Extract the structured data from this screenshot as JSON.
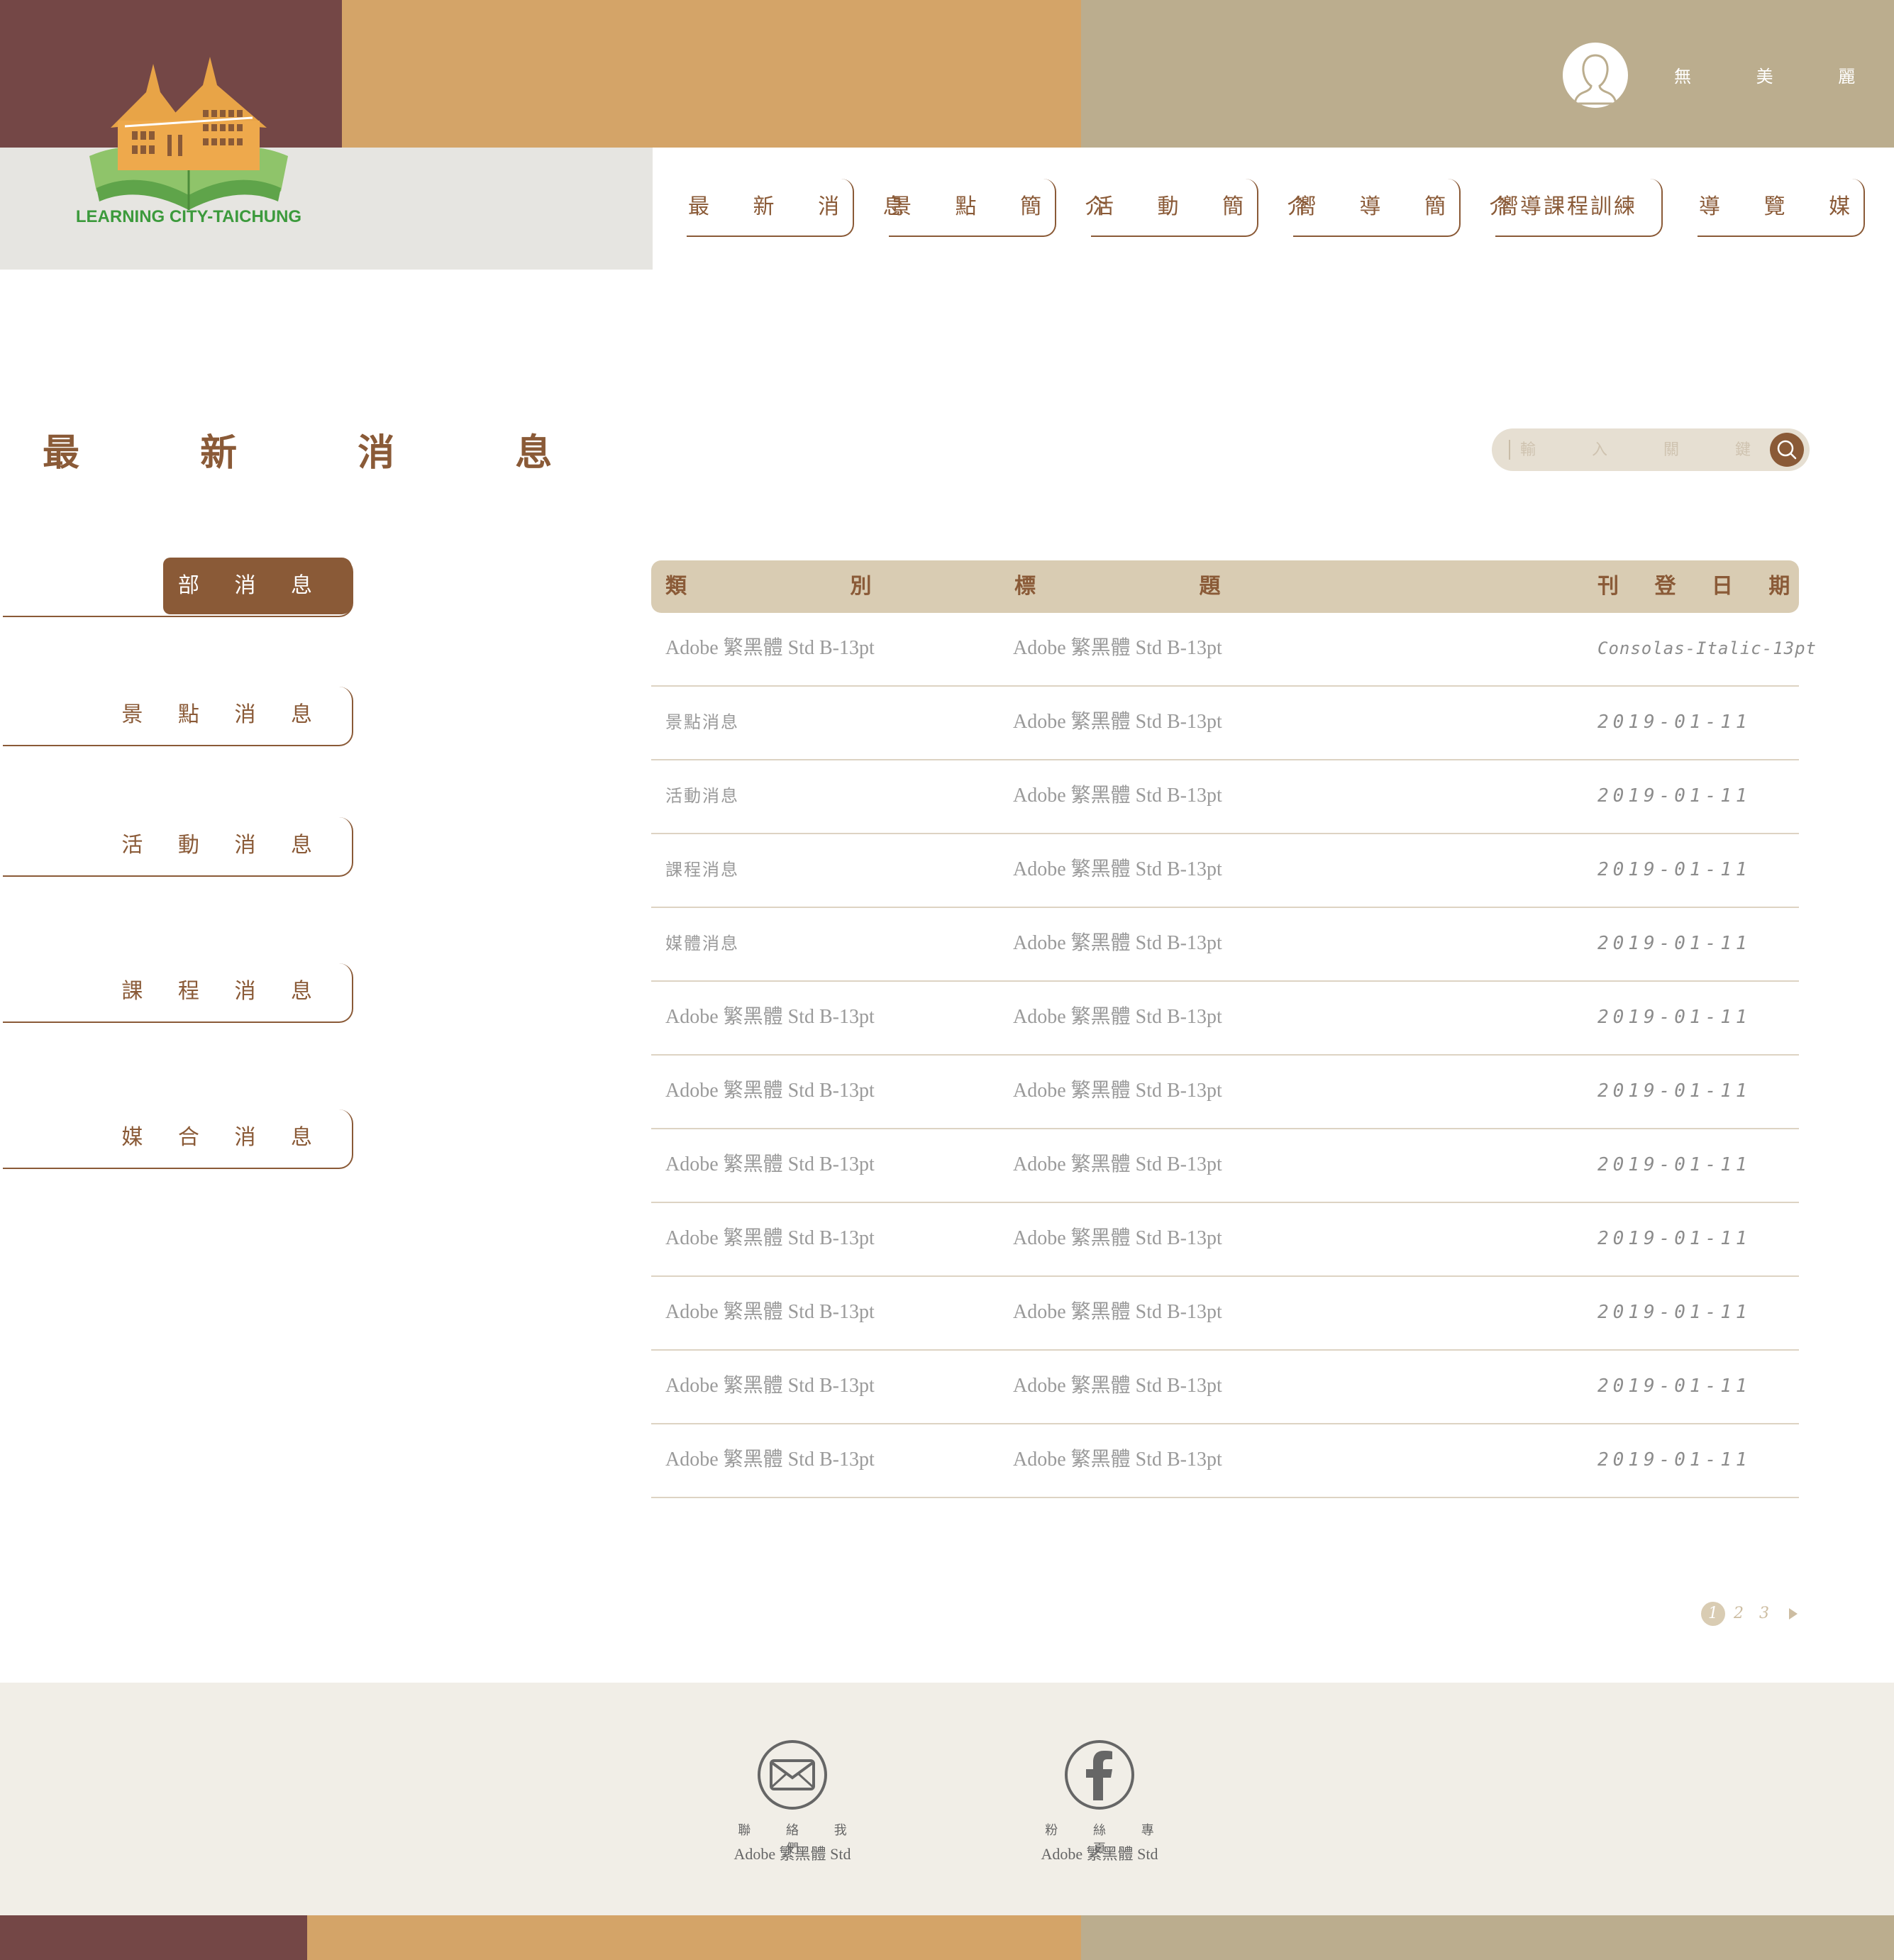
{
  "header": {
    "logo_text": "LEARNING CITY-TAICHUNG",
    "user_name": "無 美 麗",
    "nav": [
      "最 新 消 息",
      "景 點 簡 介",
      "活 動 簡 介",
      "嚮 導 簡 介",
      "嚮導課程訓練",
      "導 覽 媒 合"
    ]
  },
  "page": {
    "title": "最 新 消 息",
    "search_placeholder": "輸 入 關 鍵 字"
  },
  "sidebar": {
    "items": [
      "全 部 消 息",
      "景 點 消 息",
      "活 動 消 息",
      "課 程 消 息",
      "媒 合 消 息"
    ],
    "active_index": 0
  },
  "table": {
    "headers": {
      "category": "類 別",
      "title": "標 題",
      "date": "刊 登 日 期"
    },
    "rows": [
      {
        "category": "Adobe 繁黑體 Std B-13pt",
        "title": "Adobe 繁黑體 Std B-13pt",
        "date": "Consolas-Italic-13pt"
      },
      {
        "category": "景點消息",
        "title": "Adobe 繁黑體 Std B-13pt",
        "date": "2019-01-11"
      },
      {
        "category": "活動消息",
        "title": "Adobe 繁黑體 Std B-13pt",
        "date": "2019-01-11"
      },
      {
        "category": "課程消息",
        "title": "Adobe 繁黑體 Std B-13pt",
        "date": "2019-01-11"
      },
      {
        "category": "媒體消息",
        "title": "Adobe 繁黑體 Std B-13pt",
        "date": "2019-01-11"
      },
      {
        "category": "Adobe 繁黑體 Std B-13pt",
        "title": "Adobe 繁黑體 Std B-13pt",
        "date": "2019-01-11"
      },
      {
        "category": "Adobe 繁黑體 Std B-13pt",
        "title": "Adobe 繁黑體 Std B-13pt",
        "date": "2019-01-11"
      },
      {
        "category": "Adobe 繁黑體 Std B-13pt",
        "title": "Adobe 繁黑體 Std B-13pt",
        "date": "2019-01-11"
      },
      {
        "category": "Adobe 繁黑體 Std B-13pt",
        "title": "Adobe 繁黑體 Std B-13pt",
        "date": "2019-01-11"
      },
      {
        "category": "Adobe 繁黑體 Std B-13pt",
        "title": "Adobe 繁黑體 Std B-13pt",
        "date": "2019-01-11"
      },
      {
        "category": "Adobe 繁黑體 Std B-13pt",
        "title": "Adobe 繁黑體 Std B-13pt",
        "date": "2019-01-11"
      },
      {
        "category": "Adobe 繁黑體 Std B-13pt",
        "title": "Adobe 繁黑體 Std B-13pt",
        "date": "2019-01-11"
      }
    ]
  },
  "pagination": {
    "pages": [
      "1",
      "2",
      "3"
    ],
    "current": "1",
    "next_icon": "play-arrow-icon"
  },
  "footer": {
    "contact": {
      "label": "聯 絡 我 們",
      "sub": "Adobe 繁黑體 Std",
      "icon": "mail-icon"
    },
    "facebook": {
      "label": "粉 絲 專 頁",
      "sub": "Adobe 繁黑體 Std",
      "icon": "facebook-icon"
    }
  },
  "colors": {
    "maroon": "#744746",
    "orange": "#d4a468",
    "khaki": "#bbad8e",
    "brown_accent": "#8a5a37",
    "table_header": "#d9ccb3",
    "footer_bg": "#f1eee7"
  }
}
